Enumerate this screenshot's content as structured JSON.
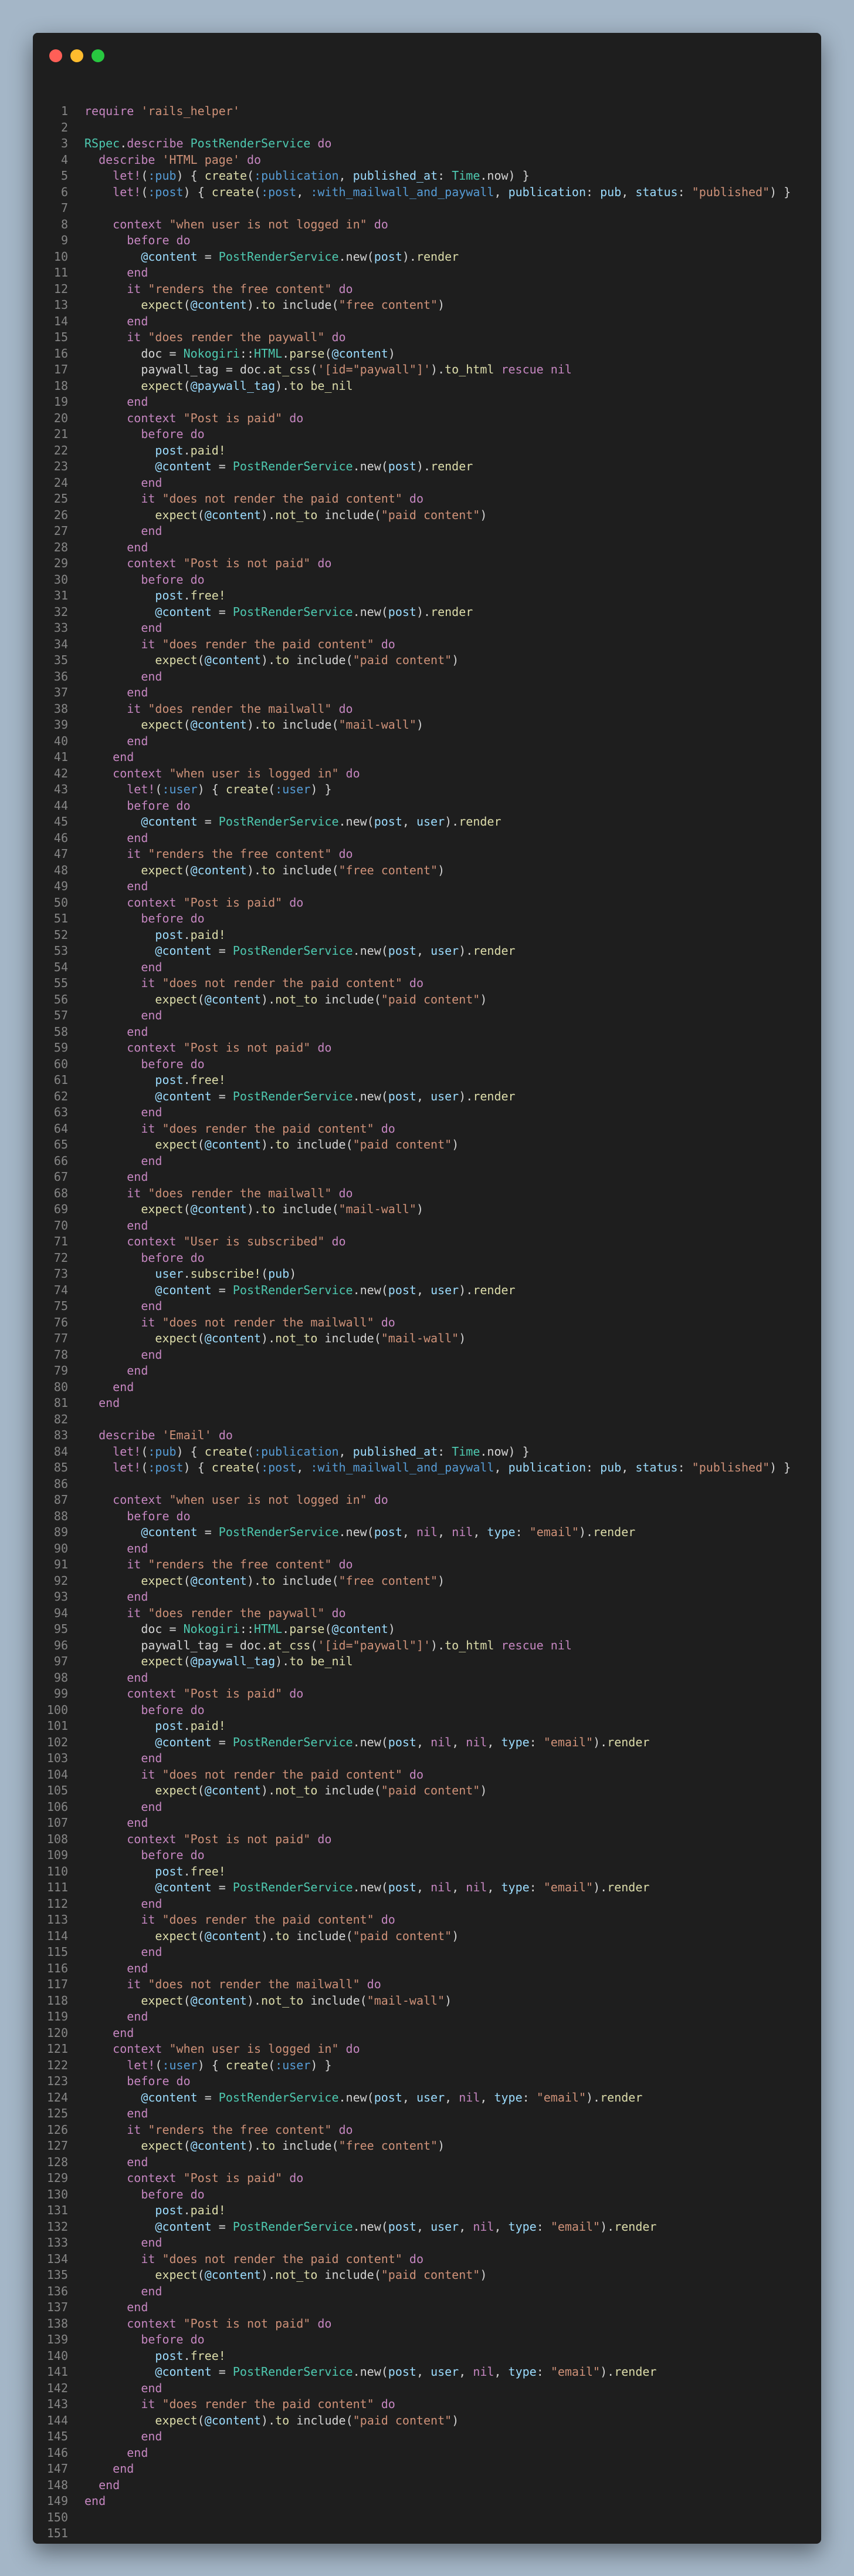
{
  "window": {
    "controls": [
      "close",
      "minimize",
      "maximize"
    ],
    "colors": {
      "close": "#ff5f57",
      "minimize": "#febc2e",
      "maximize": "#28c840",
      "background": "#1e1e1e",
      "page": "#a4b6c7"
    }
  },
  "editor": {
    "language": "ruby",
    "line_start": 1,
    "lines": [
      "require 'rails_helper'",
      "",
      "RSpec.describe PostRenderService do",
      "  describe 'HTML page' do",
      "    let!(:pub) { create(:publication, published_at: Time.now) }",
      "    let!(:post) { create(:post, :with_mailwall_and_paywall, publication: pub, status: \"published\") }",
      "",
      "    context \"when user is not logged in\" do",
      "      before do",
      "        @content = PostRenderService.new(post).render",
      "      end",
      "      it \"renders the free content\" do",
      "        expect(@content).to include(\"free content\")",
      "      end",
      "      it \"does render the paywall\" do",
      "        doc = Nokogiri::HTML.parse(@content)",
      "        paywall_tag = doc.at_css('[id=\"paywall\"]').to_html rescue nil",
      "        expect(@paywall_tag).to be_nil",
      "      end",
      "      context \"Post is paid\" do",
      "        before do",
      "          post.paid!",
      "          @content = PostRenderService.new(post).render",
      "        end",
      "        it \"does not render the paid content\" do",
      "          expect(@content).not_to include(\"paid content\")",
      "        end",
      "      end",
      "      context \"Post is not paid\" do",
      "        before do",
      "          post.free!",
      "          @content = PostRenderService.new(post).render",
      "        end",
      "        it \"does render the paid content\" do",
      "          expect(@content).to include(\"paid content\")",
      "        end",
      "      end",
      "      it \"does render the mailwall\" do",
      "        expect(@content).to include(\"mail-wall\")",
      "      end",
      "    end",
      "    context \"when user is logged in\" do",
      "      let!(:user) { create(:user) }",
      "      before do",
      "        @content = PostRenderService.new(post, user).render",
      "      end",
      "      it \"renders the free content\" do",
      "        expect(@content).to include(\"free content\")",
      "      end",
      "      context \"Post is paid\" do",
      "        before do",
      "          post.paid!",
      "          @content = PostRenderService.new(post, user).render",
      "        end",
      "        it \"does not render the paid content\" do",
      "          expect(@content).not_to include(\"paid content\")",
      "        end",
      "      end",
      "      context \"Post is not paid\" do",
      "        before do",
      "          post.free!",
      "          @content = PostRenderService.new(post, user).render",
      "        end",
      "        it \"does render the paid content\" do",
      "          expect(@content).to include(\"paid content\")",
      "        end",
      "      end",
      "      it \"does render the mailwall\" do",
      "        expect(@content).to include(\"mail-wall\")",
      "      end",
      "      context \"User is subscribed\" do",
      "        before do",
      "          user.subscribe!(pub)",
      "          @content = PostRenderService.new(post, user).render",
      "        end",
      "        it \"does not render the mailwall\" do",
      "          expect(@content).not_to include(\"mail-wall\")",
      "        end",
      "      end",
      "    end",
      "  end",
      "",
      "  describe 'Email' do",
      "    let!(:pub) { create(:publication, published_at: Time.now) }",
      "    let!(:post) { create(:post, :with_mailwall_and_paywall, publication: pub, status: \"published\") }",
      "",
      "    context \"when user is not logged in\" do",
      "      before do",
      "        @content = PostRenderService.new(post, nil, nil, type: \"email\").render",
      "      end",
      "      it \"renders the free content\" do",
      "        expect(@content).to include(\"free content\")",
      "      end",
      "      it \"does render the paywall\" do",
      "        doc = Nokogiri::HTML.parse(@content)",
      "        paywall_tag = doc.at_css('[id=\"paywall\"]').to_html rescue nil",
      "        expect(@paywall_tag).to be_nil",
      "      end",
      "      context \"Post is paid\" do",
      "        before do",
      "          post.paid!",
      "          @content = PostRenderService.new(post, nil, nil, type: \"email\").render",
      "        end",
      "        it \"does not render the paid content\" do",
      "          expect(@content).not_to include(\"paid content\")",
      "        end",
      "      end",
      "      context \"Post is not paid\" do",
      "        before do",
      "          post.free!",
      "          @content = PostRenderService.new(post, nil, nil, type: \"email\").render",
      "        end",
      "        it \"does render the paid content\" do",
      "          expect(@content).to include(\"paid content\")",
      "        end",
      "      end",
      "      it \"does not render the mailwall\" do",
      "        expect(@content).not_to include(\"mail-wall\")",
      "      end",
      "    end",
      "    context \"when user is logged in\" do",
      "      let!(:user) { create(:user) }",
      "      before do",
      "        @content = PostRenderService.new(post, user, nil, type: \"email\").render",
      "      end",
      "      it \"renders the free content\" do",
      "        expect(@content).to include(\"free content\")",
      "      end",
      "      context \"Post is paid\" do",
      "        before do",
      "          post.paid!",
      "          @content = PostRenderService.new(post, user, nil, type: \"email\").render",
      "        end",
      "        it \"does not render the paid content\" do",
      "          expect(@content).not_to include(\"paid content\")",
      "        end",
      "      end",
      "      context \"Post is not paid\" do",
      "        before do",
      "          post.free!",
      "          @content = PostRenderService.new(post, user, nil, type: \"email\").render",
      "        end",
      "        it \"does render the paid content\" do",
      "          expect(@content).to include(\"paid content\")",
      "        end",
      "      end",
      "    end",
      "  end",
      "end",
      "",
      "",
      ""
    ]
  }
}
